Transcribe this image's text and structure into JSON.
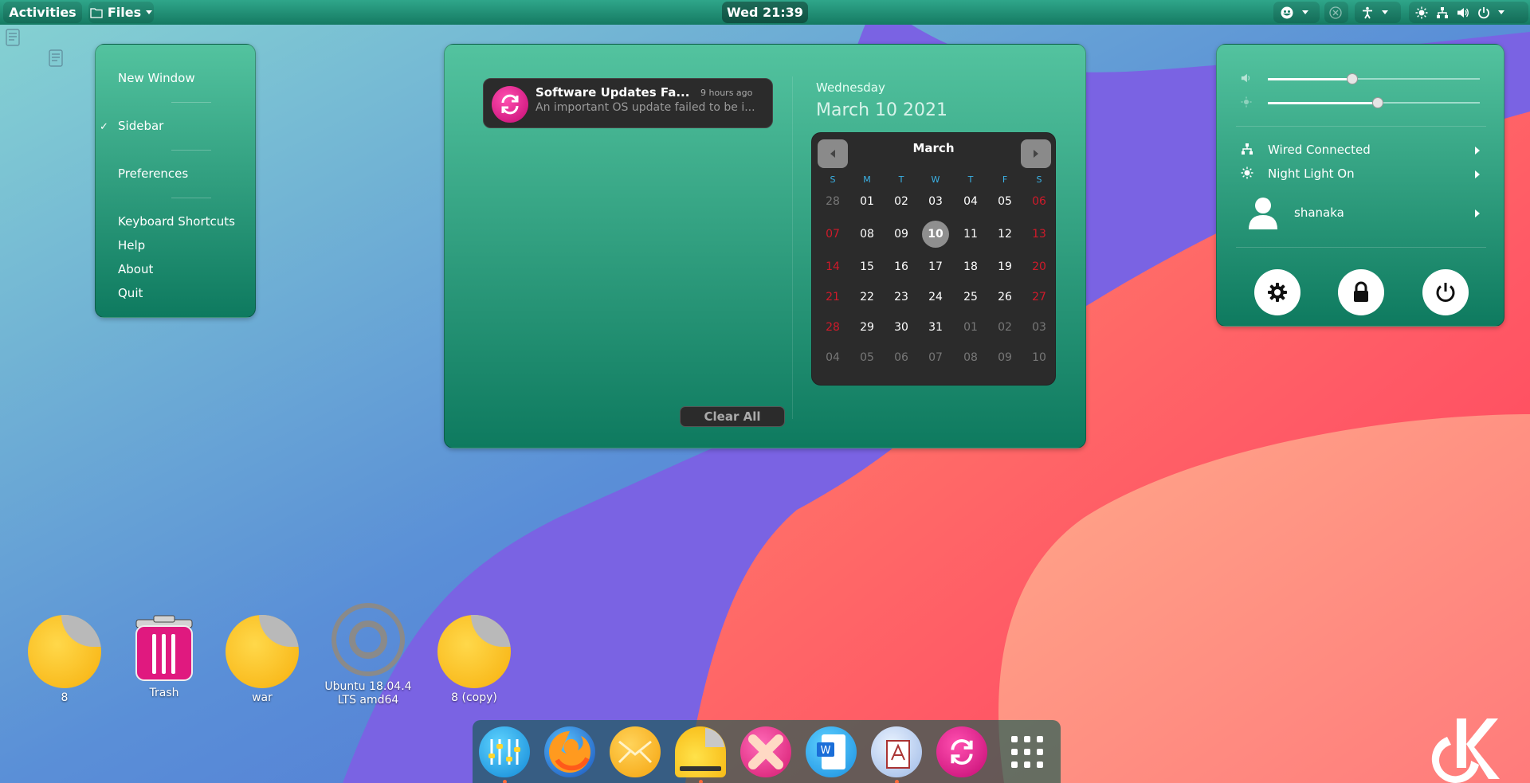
{
  "topbar": {
    "activities": "Activities",
    "app_name": "Files",
    "clock": "Wed 21:39"
  },
  "files_menu": {
    "items": [
      {
        "label": "New Window"
      },
      {
        "label": "Sidebar",
        "checked": true
      },
      {
        "label": "Preferences"
      },
      {
        "label": "Keyboard Shortcuts"
      },
      {
        "label": "Help"
      },
      {
        "label": "About"
      },
      {
        "label": "Quit"
      }
    ],
    "check_mark": "✓"
  },
  "notification": {
    "title": "Software Updates Fa...",
    "time": "9 hours ago",
    "body": "An important OS update failed to be i..."
  },
  "clear_all": "Clear All",
  "date": {
    "weekday": "Wednesday",
    "long": "March 10 2021"
  },
  "calendar": {
    "month": "March",
    "headers": [
      "S",
      "M",
      "T",
      "W",
      "T",
      "F",
      "S"
    ],
    "weeks": [
      [
        "28",
        "01",
        "02",
        "03",
        "04",
        "05",
        "06"
      ],
      [
        "07",
        "08",
        "09",
        "10",
        "11",
        "12",
        "13"
      ],
      [
        "14",
        "15",
        "16",
        "17",
        "18",
        "19",
        "20"
      ],
      [
        "21",
        "22",
        "23",
        "24",
        "25",
        "26",
        "27"
      ],
      [
        "28",
        "29",
        "30",
        "31",
        "01",
        "02",
        "03"
      ],
      [
        "04",
        "05",
        "06",
        "07",
        "08",
        "09",
        "10"
      ]
    ],
    "other_month": [
      [
        0,
        0
      ],
      [
        4,
        4
      ],
      [
        4,
        5
      ],
      [
        4,
        6
      ],
      [
        5,
        0
      ],
      [
        5,
        1
      ],
      [
        5,
        2
      ],
      [
        5,
        3
      ],
      [
        5,
        4
      ],
      [
        5,
        5
      ],
      [
        5,
        6
      ]
    ],
    "today": [
      1,
      3
    ]
  },
  "system": {
    "volume_level": 0.4,
    "brightness_level": 0.52,
    "network": "Wired Connected",
    "night_light": "Night Light On",
    "user": "shanaka"
  },
  "desktop_icons": [
    {
      "label": "8",
      "kind": "folder"
    },
    {
      "label": "Trash",
      "kind": "trash"
    },
    {
      "label": "war",
      "kind": "folder"
    },
    {
      "label": "Ubuntu 18.04.4 LTS amd64",
      "kind": "disc"
    },
    {
      "label": "8 (copy)",
      "kind": "folder"
    }
  ],
  "dock_apps": [
    {
      "name": "settings-mixer",
      "running": true
    },
    {
      "name": "firefox",
      "running": false
    },
    {
      "name": "mail",
      "running": false
    },
    {
      "name": "files",
      "running": true
    },
    {
      "name": "tweaks",
      "running": false
    },
    {
      "name": "writer",
      "running": false
    },
    {
      "name": "text-editor",
      "running": true
    },
    {
      "name": "software-updater",
      "running": false
    },
    {
      "name": "show-apps",
      "running": false
    }
  ],
  "colors": {
    "panel_green": "#2fa68a",
    "weekend_red": "#d11a2a",
    "calendar_header_blue": "#3bb2e6"
  }
}
